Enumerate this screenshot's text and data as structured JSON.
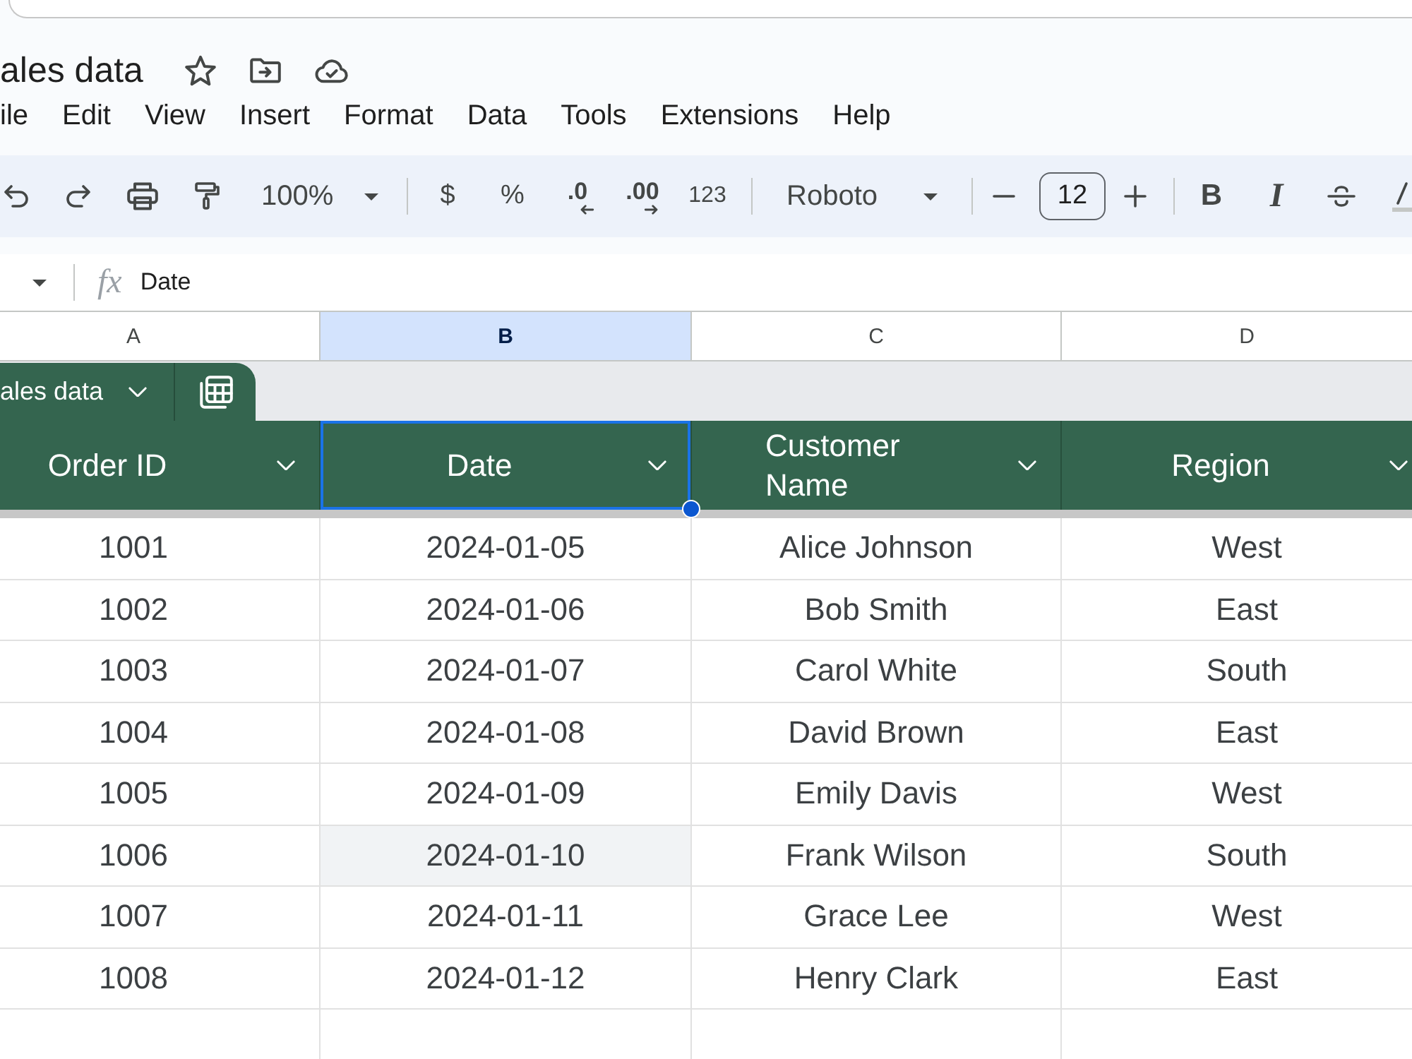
{
  "document": {
    "title": "ales data",
    "starred": false
  },
  "menu": [
    "ile",
    "Edit",
    "View",
    "Insert",
    "Format",
    "Data",
    "Tools",
    "Extensions",
    "Help"
  ],
  "toolbar": {
    "zoom": "100%",
    "currency": "$",
    "percent": "%",
    "decrease_decimals": ".0",
    "increase_decimals": ".00",
    "number_format": "123",
    "font": "Roboto",
    "font_size": "12",
    "bold": "B",
    "italic": "I"
  },
  "formula_bar": {
    "function_label": "fx",
    "content": "Date"
  },
  "column_headers": [
    {
      "letter": "A",
      "selected": false
    },
    {
      "letter": "B",
      "selected": true
    },
    {
      "letter": "C",
      "selected": false
    },
    {
      "letter": "D",
      "selected": false
    }
  ],
  "table": {
    "name": "ales data",
    "headers": [
      {
        "text": "Order ID",
        "selected": false
      },
      {
        "text": "Date",
        "selected": true
      },
      {
        "text": "Customer Name",
        "selected": false
      },
      {
        "text": "Region",
        "selected": false
      }
    ],
    "rows": [
      [
        {
          "text": "1001",
          "hovered": false
        },
        {
          "text": "2024-01-05",
          "hovered": false
        },
        {
          "text": "Alice Johnson",
          "hovered": false
        },
        {
          "text": "West",
          "hovered": false
        }
      ],
      [
        {
          "text": "1002",
          "hovered": false
        },
        {
          "text": "2024-01-06",
          "hovered": false
        },
        {
          "text": "Bob Smith",
          "hovered": false
        },
        {
          "text": "East",
          "hovered": false
        }
      ],
      [
        {
          "text": "1003",
          "hovered": false
        },
        {
          "text": "2024-01-07",
          "hovered": false
        },
        {
          "text": "Carol White",
          "hovered": false
        },
        {
          "text": "South",
          "hovered": false
        }
      ],
      [
        {
          "text": "1004",
          "hovered": false
        },
        {
          "text": "2024-01-08",
          "hovered": false
        },
        {
          "text": "David Brown",
          "hovered": false
        },
        {
          "text": "East",
          "hovered": false
        }
      ],
      [
        {
          "text": "1005",
          "hovered": false
        },
        {
          "text": "2024-01-09",
          "hovered": false
        },
        {
          "text": "Emily Davis",
          "hovered": false
        },
        {
          "text": "West",
          "hovered": false
        }
      ],
      [
        {
          "text": "1006",
          "hovered": false
        },
        {
          "text": "2024-01-10",
          "hovered": true
        },
        {
          "text": "Frank Wilson",
          "hovered": false
        },
        {
          "text": "South",
          "hovered": false
        }
      ],
      [
        {
          "text": "1007",
          "hovered": false
        },
        {
          "text": "2024-01-11",
          "hovered": false
        },
        {
          "text": "Grace Lee",
          "hovered": false
        },
        {
          "text": "West",
          "hovered": false
        }
      ],
      [
        {
          "text": "1008",
          "hovered": false
        },
        {
          "text": "2024-01-12",
          "hovered": false
        },
        {
          "text": "Henry Clark",
          "hovered": false
        },
        {
          "text": "East",
          "hovered": false
        }
      ]
    ]
  }
}
